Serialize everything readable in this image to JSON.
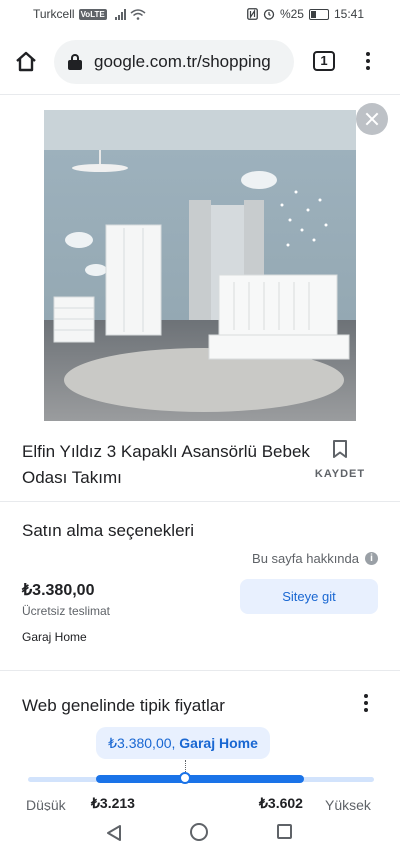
{
  "status_bar": {
    "carrier": "Turkcell",
    "volte_badge": "VoLTE",
    "battery": "%25",
    "time": "15:41"
  },
  "browser": {
    "url": "google.com.tr/shopping",
    "tab_count": "1"
  },
  "product": {
    "title": "Elfin Yıldız 3 Kapaklı Asansörlü Bebek Odası Takımı",
    "save_label": "KAYDET"
  },
  "buying_options": {
    "heading": "Satın alma seçenekleri",
    "about_page": "Bu sayfa hakkında",
    "price": "₺3.380,00",
    "shipping": "Ücretsiz teslimat",
    "visit_button": "Siteye git",
    "merchant": "Garaj Home"
  },
  "typical_prices": {
    "heading": "Web genelinde tipik fiyatlar",
    "bubble_price": "₺3.380,00,",
    "bubble_store": "Garaj Home",
    "low_label": "Düşük",
    "high_label": "Yüksek",
    "low_value": "₺3.213",
    "high_value": "₺3.602"
  }
}
